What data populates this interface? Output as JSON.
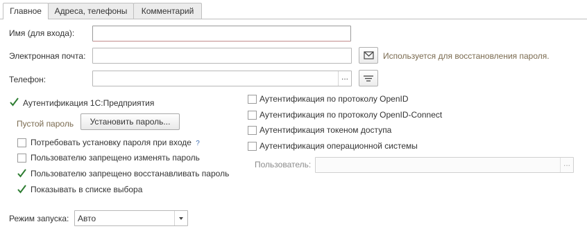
{
  "tabs": [
    {
      "label": "Главное",
      "active": true
    },
    {
      "label": "Адреса, телефоны",
      "active": false
    },
    {
      "label": "Комментарий",
      "active": false
    }
  ],
  "form": {
    "login_label": "Имя (для входа):",
    "login_value": "",
    "email_label": "Электронная почта:",
    "email_value": "",
    "email_hint": "Используется для восстановления пароля.",
    "phone_label": "Телефон:",
    "phone_value": "",
    "phone_dots": "...",
    "user_dots": "...",
    "icons": {
      "email_button": "envelope-icon",
      "phone_button": "list-lines-icon",
      "select_arrow": "triangle-down-icon",
      "checkmark": "check-icon",
      "help": "question-icon"
    }
  },
  "auth_1c": {
    "label": "Аутентификация 1С:Предприятия",
    "checked": true,
    "empty_password_label": "Пустой пароль",
    "set_password_button": "Установить пароль..."
  },
  "options": [
    {
      "label": "Потребовать установку пароля при входе",
      "checked": false,
      "help": "?"
    },
    {
      "label": "Пользователю запрещено изменять пароль",
      "checked": false
    },
    {
      "label": "Пользователю запрещено восстанавливать пароль",
      "checked": true
    },
    {
      "label": "Показывать в списке выбора",
      "checked": true
    }
  ],
  "right_options": [
    {
      "label": "Аутентификация по протоколу OpenID",
      "checked": false
    },
    {
      "label": "Аутентификация по протоколу OpenID-Connect",
      "checked": false
    },
    {
      "label": "Аутентификация токеном доступа",
      "checked": false
    },
    {
      "label": "Аутентификация операционной системы",
      "checked": false
    }
  ],
  "os_user": {
    "label": "Пользователь:",
    "value": ""
  },
  "launch_mode": {
    "label": "Режим запуска:",
    "value": "Авто"
  },
  "colors": {
    "hint": "#7a6a4f",
    "check": "#2e7d32",
    "tab_border": "#bfbfbf"
  }
}
